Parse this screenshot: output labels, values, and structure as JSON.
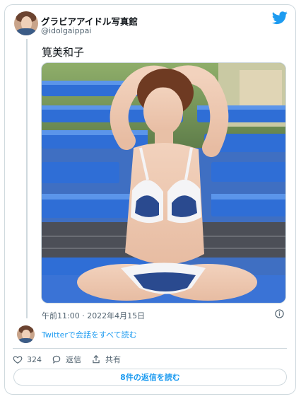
{
  "tweet": {
    "author_name": "グラビアアイドル写真館",
    "author_handle": "@idolgaippai",
    "text": "筧美和子",
    "timestamp": "午前11:00 · 2022年4月15日",
    "media_icon": "photo-of-woman-in-bikini-by-poolside-loungers"
  },
  "conversation": {
    "link_label": "Twitterで会話をすべて読む"
  },
  "actions": {
    "like_count": "324",
    "reply_label": "返信",
    "share_label": "共有"
  },
  "footer": {
    "read_replies_label": "8件の返信を読む"
  },
  "colors": {
    "accent": "#1d9bf0",
    "secondary_text": "#536471",
    "border": "#cfd9de"
  }
}
